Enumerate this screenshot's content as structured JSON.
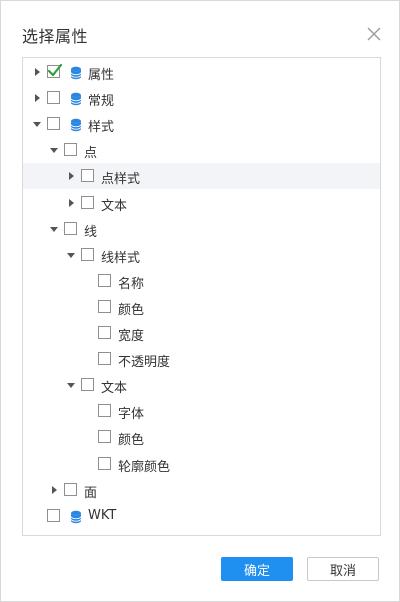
{
  "dialog": {
    "title": "选择属性",
    "ok_label": "确定",
    "cancel_label": "取消"
  },
  "tree": [
    {
      "label": "属性",
      "level": 0,
      "toggle": "collapsed",
      "checked": true,
      "db_icon": true
    },
    {
      "label": "常规",
      "level": 0,
      "toggle": "collapsed",
      "checked": false,
      "db_icon": true
    },
    {
      "label": "样式",
      "level": 0,
      "toggle": "expanded",
      "checked": false,
      "db_icon": true
    },
    {
      "label": "点",
      "level": 1,
      "toggle": "expanded",
      "checked": false,
      "db_icon": false
    },
    {
      "label": "点样式",
      "level": 2,
      "toggle": "collapsed",
      "checked": false,
      "db_icon": false,
      "hover": true
    },
    {
      "label": "文本",
      "level": 2,
      "toggle": "collapsed",
      "checked": false,
      "db_icon": false
    },
    {
      "label": "线",
      "level": 1,
      "toggle": "expanded",
      "checked": false,
      "db_icon": false
    },
    {
      "label": "线样式",
      "level": 2,
      "toggle": "expanded",
      "checked": false,
      "db_icon": false
    },
    {
      "label": "名称",
      "level": 3,
      "toggle": "none",
      "checked": false,
      "db_icon": false
    },
    {
      "label": "颜色",
      "level": 3,
      "toggle": "none",
      "checked": false,
      "db_icon": false
    },
    {
      "label": "宽度",
      "level": 3,
      "toggle": "none",
      "checked": false,
      "db_icon": false
    },
    {
      "label": "不透明度",
      "level": 3,
      "toggle": "none",
      "checked": false,
      "db_icon": false
    },
    {
      "label": "文本",
      "level": 2,
      "toggle": "expanded",
      "checked": false,
      "db_icon": false
    },
    {
      "label": "字体",
      "level": 3,
      "toggle": "none",
      "checked": false,
      "db_icon": false
    },
    {
      "label": "颜色",
      "level": 3,
      "toggle": "none",
      "checked": false,
      "db_icon": false
    },
    {
      "label": "轮廓颜色",
      "level": 3,
      "toggle": "none",
      "checked": false,
      "db_icon": false
    },
    {
      "label": "面",
      "level": 1,
      "toggle": "collapsed",
      "checked": false,
      "db_icon": false
    },
    {
      "label": "WKT",
      "level": 0,
      "toggle": "none",
      "checked": false,
      "db_icon": true
    }
  ],
  "colors": {
    "accent": "#1f8ff0",
    "check": "#2e9e3e",
    "db_icon": "#2a86e0",
    "hover_row": "#f2f4f7"
  },
  "icons": {
    "close": "close-icon",
    "expanded": "caret-down-icon",
    "collapsed": "caret-right-icon",
    "database": "database-icon",
    "check": "checkmark-icon"
  }
}
